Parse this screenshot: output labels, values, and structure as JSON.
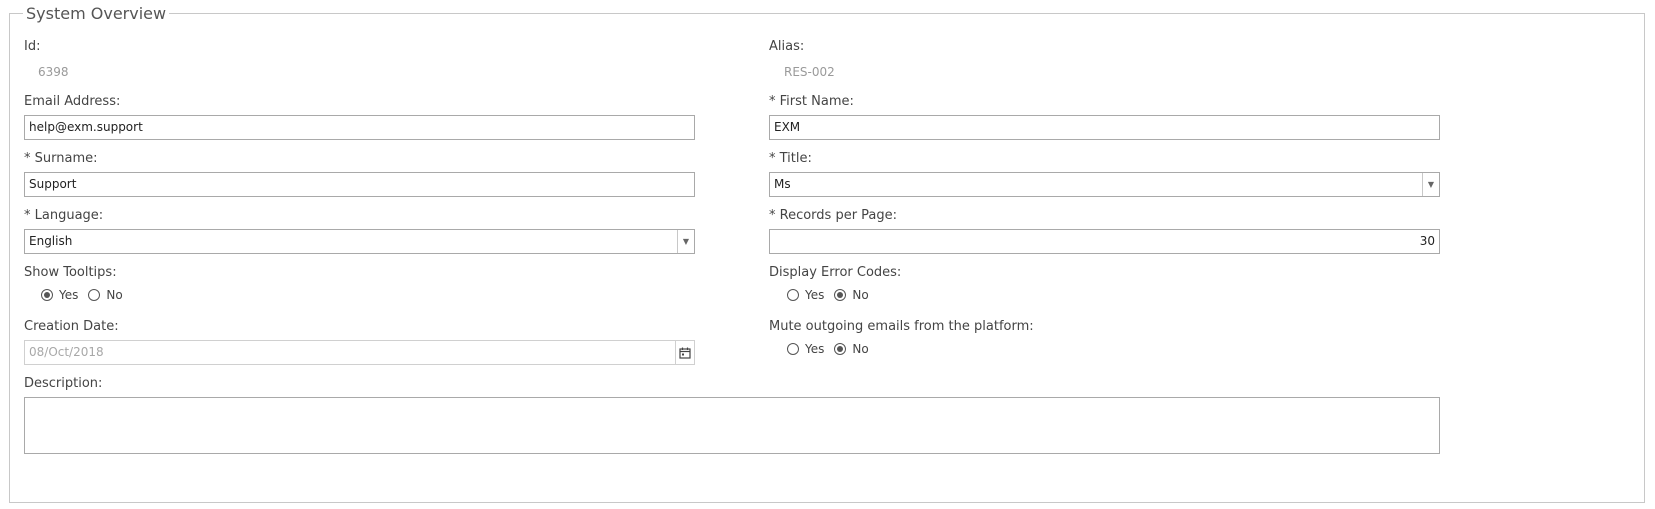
{
  "section": {
    "title": "System Overview"
  },
  "fields": {
    "id": {
      "label": "Id:",
      "value": "6398"
    },
    "alias": {
      "label": "Alias:",
      "value": "RES-002"
    },
    "email": {
      "label": "Email Address:",
      "value": "help@exm.support"
    },
    "first_name": {
      "label": "* First Name:",
      "value": "EXM"
    },
    "surname": {
      "label": "* Surname:",
      "value": "Support"
    },
    "title": {
      "label": "* Title:",
      "value": "Ms"
    },
    "language": {
      "label": "* Language:",
      "value": "English"
    },
    "records_per_page": {
      "label": "* Records per Page:",
      "value": "30"
    },
    "show_tooltips": {
      "label": "Show Tooltips:",
      "yes": "Yes",
      "no": "No",
      "selected": "Yes"
    },
    "display_error_codes": {
      "label": "Display Error Codes:",
      "yes": "Yes",
      "no": "No",
      "selected": "No"
    },
    "creation_date": {
      "label": "Creation Date:",
      "value": "08/Oct/2018"
    },
    "mute_emails": {
      "label": "Mute outgoing emails from the platform:",
      "yes": "Yes",
      "no": "No",
      "selected": "No"
    },
    "description": {
      "label": "Description:",
      "value": ""
    }
  },
  "icons": {
    "dropdown": "chevron-down-icon",
    "calendar": "calendar-icon"
  }
}
